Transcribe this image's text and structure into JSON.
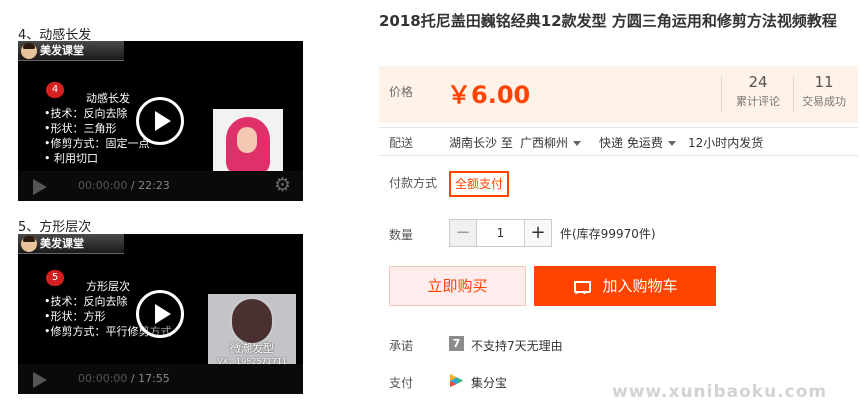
{
  "videos": [
    {
      "section_title": "4、动感长发",
      "channel": "美发课堂",
      "badge": "4",
      "lines": [
        "动感长发",
        "•技术：反向去除",
        "•形状：三角形",
        "•修剪方式：固定一点",
        "•            利用切口"
      ],
      "time_current": "00:00:00",
      "time_total": "22:23",
      "thumb_watermark": "",
      "thumb_watermark_sub": ""
    },
    {
      "section_title": "5、方形层次",
      "channel": "美发课堂",
      "badge": "5",
      "lines": [
        "方形层次",
        "•技术：反向去除",
        "•形状：方形",
        "•修剪方式：平行修剪方式"
      ],
      "time_current": "00:00:00",
      "time_total": "17:55",
      "thumb_watermark": "微潮发型",
      "thumb_watermark_sub": "VX：1952571711"
    }
  ],
  "product": {
    "title": "2018托尼盖田巍铭经典12款发型 方圆三角运用和修剪方法视频教程",
    "price_label": "价格",
    "price": "￥6.00",
    "reviews_count": "24",
    "reviews_label": "累计评论",
    "deals_count": "11",
    "deals_label": "交易成功",
    "ship_label": "配送",
    "ship_from": "湖南长沙 至",
    "ship_to": "广西柳州",
    "ship_method": "快递 免运费",
    "ship_time": "12小时内发货",
    "pay_label": "付款方式",
    "pay_option": "全额支付",
    "qty_label": "数量",
    "qty_value": "1",
    "qty_minus": "−",
    "qty_plus": "+",
    "stock": "件(库存99970件)",
    "buy_now": "立即购买",
    "add_cart": "加入购物车",
    "promise_label": "承诺",
    "promise_icon_text": "7",
    "promise_text": "不支持7天无理由",
    "payment_label": "支付",
    "payment_text": "集分宝"
  },
  "watermark": "www.xunibaoku.com",
  "colors": {
    "accent": "#ff4400",
    "price_bg": "#fff2e8",
    "badge_red": "#d42020"
  }
}
